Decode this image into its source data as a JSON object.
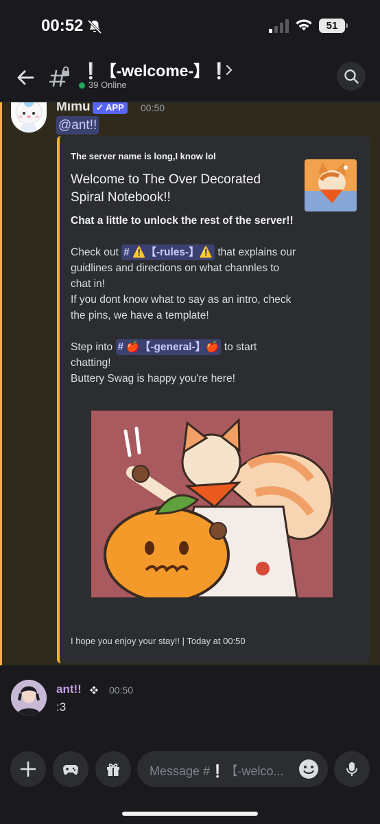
{
  "status_bar": {
    "time": "00:52",
    "battery": "51"
  },
  "header": {
    "channel_name": "❕【-welcome-】❕",
    "online": "39 Online"
  },
  "message1": {
    "author": "Mimu",
    "badge": "✓ APP",
    "time": "00:50",
    "mention": "@ant!!",
    "embed": {
      "author": "The server name is long,I know lol",
      "title": "Welcome to The Over Decorated Spiral Notebook!!",
      "bold_line": "Chat a little to unlock the rest of the server!!",
      "check_out": "Check out",
      "rules_channel": "# ⚠️【-rules-】⚠️",
      "rules_after": "that explains our guidlines and directions on what channles to chat in!",
      "intro_tip": "If you dont know what to say as an intro, check the pins, we have a template!",
      "step_into": "Step into",
      "general_channel": "# 🍎【-general-】🍎",
      "general_after": "to start chatting!",
      "happy_line": "Buttery Swag is happy you're here!",
      "footer": "I hope you enjoy your stay!! | Today at 00:50"
    }
  },
  "message2": {
    "author": "ant!!",
    "time": "00:50",
    "text": ":3"
  },
  "composer": {
    "placeholder": "Message #❕【-welco..."
  },
  "colors": {
    "accent": "#5865f2",
    "mention_bar": "#f0b232",
    "online": "#23a55a"
  },
  "icons": [
    "back-icon",
    "channel-icon",
    "search-icon",
    "plus-icon",
    "gamepad-icon",
    "gift-icon",
    "emoji-icon",
    "mic-icon"
  ]
}
